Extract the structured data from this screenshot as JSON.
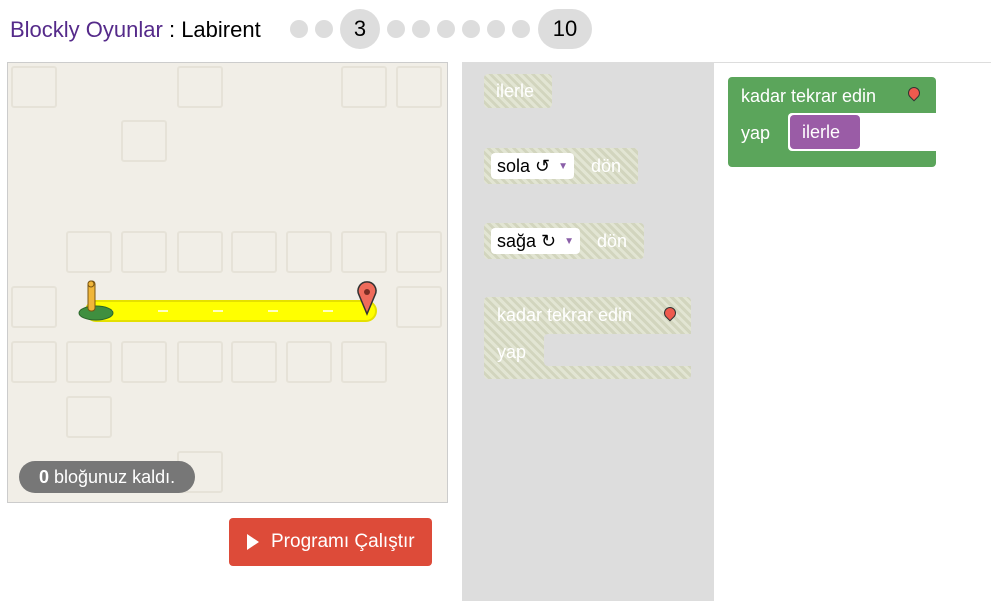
{
  "header": {
    "app_name": "Blockly Oyunlar",
    "separator": " : ",
    "game_name": "Labirent",
    "current_level": "3",
    "last_level": "10"
  },
  "maze": {
    "capacity_count": "0",
    "capacity_text": " bloğunuz kaldı."
  },
  "run_button": {
    "label": "Programı Çalıştır"
  },
  "toolbox": {
    "move_forward": "ilerle",
    "turn_left_label": "sola ↺",
    "turn_left_suffix": "dön",
    "turn_right_label": "sağa ↻",
    "turn_right_suffix": "dön",
    "repeat_label": "kadar tekrar edin",
    "repeat_do": "yap"
  },
  "workspace": {
    "repeat_label": "kadar tekrar edin",
    "repeat_do": "yap",
    "inner_block": "ilerle"
  },
  "colors": {
    "accent": "#552a8a",
    "run_button": "#dd4b39",
    "loop_block": "#5ba55b",
    "movement_block": "#9a5ca6",
    "toolbox_bg": "#dddddd"
  }
}
